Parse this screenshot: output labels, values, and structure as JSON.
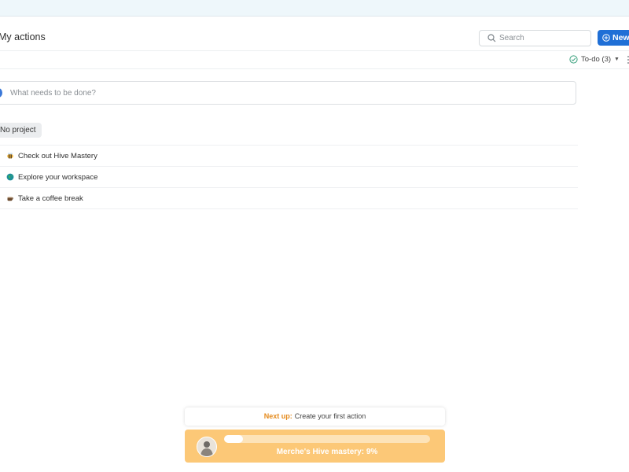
{
  "header": {
    "title": "My actions",
    "search_placeholder": "Search",
    "new_button_label": "New"
  },
  "filter": {
    "todo_label": "To-do (3)"
  },
  "task_input": {
    "placeholder": "What needs to be done?"
  },
  "project": {
    "name": "No project"
  },
  "tasks": [
    {
      "icon": "bee-icon",
      "text": "Check out Hive Mastery"
    },
    {
      "icon": "globe-icon",
      "text": "Explore your workspace"
    },
    {
      "icon": "coffee-icon",
      "text": "Take a coffee break"
    }
  ],
  "next_up": {
    "label": "Next up:",
    "text": "Create your first action"
  },
  "mastery": {
    "text": "Merche's Hive mastery: 9%",
    "progress_percent": 9
  },
  "colors": {
    "accent_blue": "#1f6fd6",
    "mastery_bg": "#fcc877",
    "next_up_orange": "#e48a1c"
  }
}
